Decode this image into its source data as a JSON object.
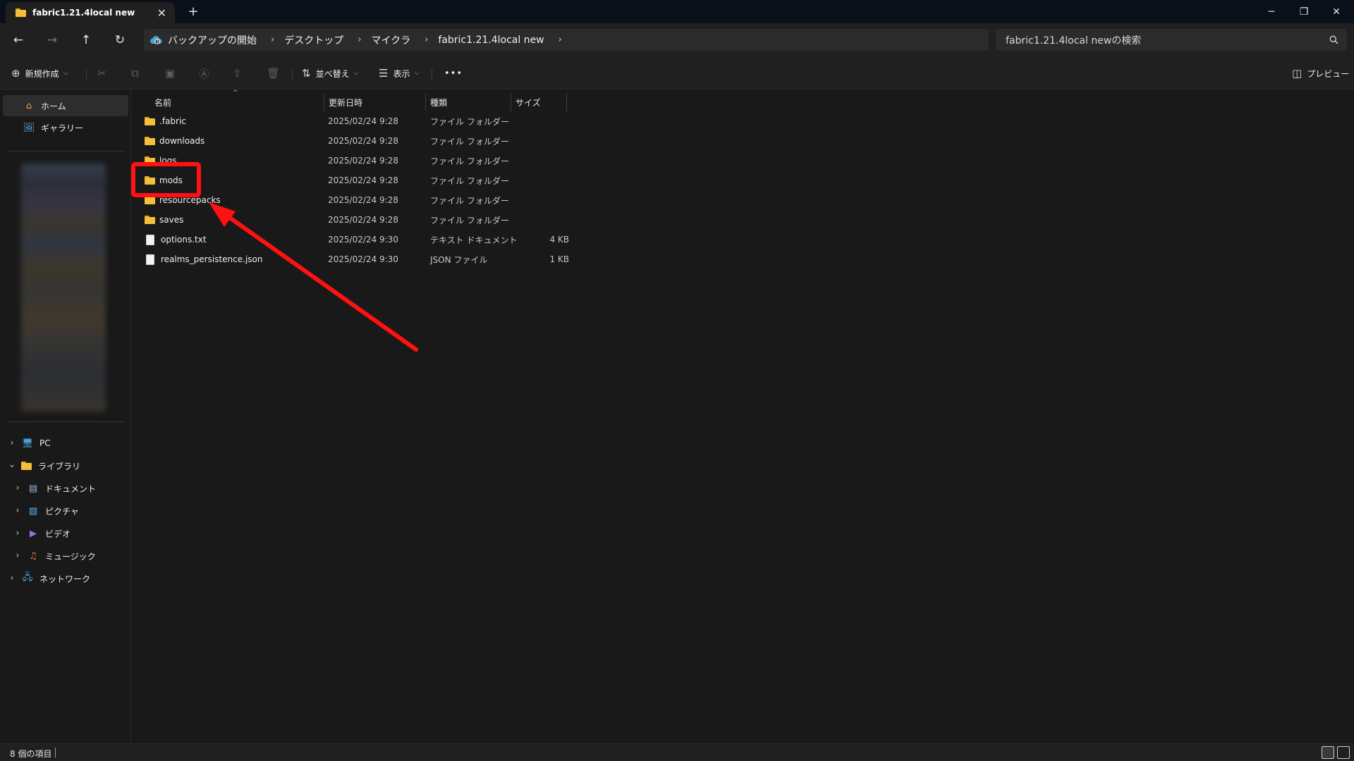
{
  "window": {
    "tab_title": "fabric1.21.4local new",
    "new_tab_icon": "plus-icon",
    "controls": [
      "minimize-icon",
      "restore-icon",
      "close-icon"
    ]
  },
  "nav": {
    "back_icon": "arrow-left-icon",
    "forward_icon": "arrow-right-icon",
    "up_icon": "arrow-up-icon",
    "refresh_icon": "refresh-icon",
    "breadcrumbs": [
      "バックアップの開始",
      "デスクトップ",
      "マイクラ",
      "fabric1.21.4local new"
    ],
    "search_placeholder": "fabric1.21.4local newの検索"
  },
  "commandbar": {
    "new_label": "新規作成",
    "sort_label": "並べ替え",
    "view_label": "表示",
    "more_label": "•••",
    "preview_label": "プレビュー"
  },
  "sidebar": {
    "top_items": [
      {
        "label": "ホーム",
        "icon": "home-icon"
      },
      {
        "label": "ギャラリー",
        "icon": "gallery-icon"
      }
    ],
    "tree": [
      {
        "label": "PC",
        "icon": "pc-icon",
        "expanded": false
      },
      {
        "label": "ライブラリ",
        "icon": "library-folder-icon",
        "expanded": true
      },
      {
        "label": "ドキュメント",
        "icon": "documents-icon",
        "expanded": false
      },
      {
        "label": "ピクチャ",
        "icon": "pictures-icon",
        "expanded": false
      },
      {
        "label": "ビデオ",
        "icon": "videos-icon",
        "expanded": false
      },
      {
        "label": "ミュージック",
        "icon": "music-icon",
        "expanded": false
      },
      {
        "label": "ネットワーク",
        "icon": "network-icon",
        "expanded": false
      }
    ]
  },
  "filelist": {
    "columns": {
      "name": "名前",
      "modified": "更新日時",
      "type": "種類",
      "size": "サイズ"
    },
    "rows": [
      {
        "name": ".fabric",
        "modified": "2025/02/24 9:28",
        "type": "ファイル フォルダー",
        "size": "",
        "kind": "folder"
      },
      {
        "name": "downloads",
        "modified": "2025/02/24 9:28",
        "type": "ファイル フォルダー",
        "size": "",
        "kind": "folder"
      },
      {
        "name": "logs",
        "modified": "2025/02/24 9:28",
        "type": "ファイル フォルダー",
        "size": "",
        "kind": "folder"
      },
      {
        "name": "mods",
        "modified": "2025/02/24 9:28",
        "type": "ファイル フォルダー",
        "size": "",
        "kind": "folder"
      },
      {
        "name": "resourcepacks",
        "modified": "2025/02/24 9:28",
        "type": "ファイル フォルダー",
        "size": "",
        "kind": "folder"
      },
      {
        "name": "saves",
        "modified": "2025/02/24 9:28",
        "type": "ファイル フォルダー",
        "size": "",
        "kind": "folder"
      },
      {
        "name": "options.txt",
        "modified": "2025/02/24 9:30",
        "type": "テキスト ドキュメント",
        "size": "4 KB",
        "kind": "file"
      },
      {
        "name": "realms_persistence.json",
        "modified": "2025/02/24 9:30",
        "type": "JSON ファイル",
        "size": "1 KB",
        "kind": "file"
      }
    ]
  },
  "status": {
    "item_count": "8 個の項目"
  },
  "colors": {
    "annotation_red": "#ff1111",
    "folder_yellow": "#f4bf3a"
  }
}
